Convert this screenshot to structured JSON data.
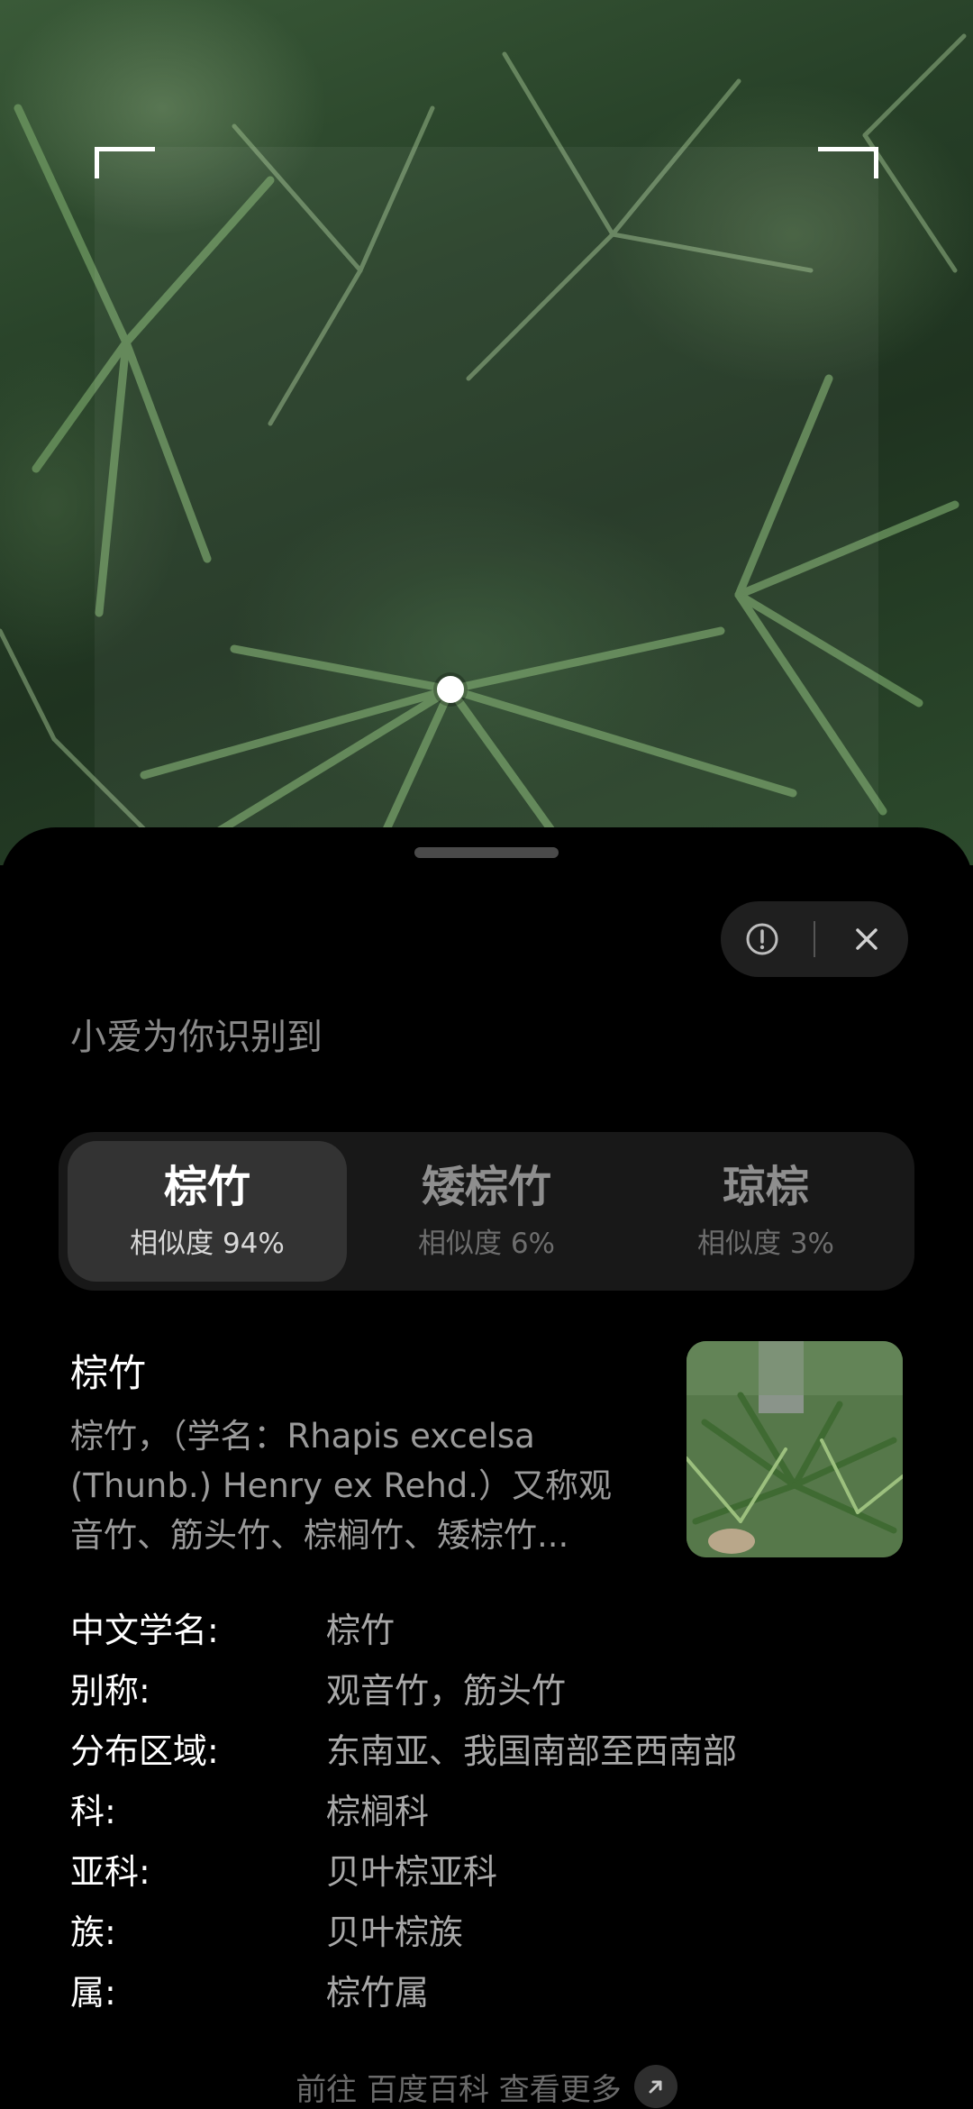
{
  "header": {
    "headline": "小爱为你识别到"
  },
  "candidates": [
    {
      "name": "棕竹",
      "similarity": "相似度 94%",
      "active": true
    },
    {
      "name": "矮棕竹",
      "similarity": "相似度 6%",
      "active": false
    },
    {
      "name": "琼棕",
      "similarity": "相似度 3%",
      "active": false
    }
  ],
  "detail": {
    "title": "棕竹",
    "description": "棕竹，（学名：Rhapis excelsa (Thunb.) Henry ex Rehd.）又称观音竹、筋头竹、棕榈竹、矮棕竹...",
    "attributes": [
      {
        "key": "中文学名:",
        "value": "棕竹"
      },
      {
        "key": "别称:",
        "value": "观音竹，筋头竹"
      },
      {
        "key": "分布区域:",
        "value": "东南亚、我国南部至西南部"
      },
      {
        "key": "科:",
        "value": "棕榈科"
      },
      {
        "key": "亚科:",
        "value": "贝叶棕亚科"
      },
      {
        "key": "族:",
        "value": "贝叶棕族"
      },
      {
        "key": "属:",
        "value": "棕竹属"
      }
    ]
  },
  "footer": {
    "more_link": "前往 百度百科 查看更多"
  },
  "icons": {
    "feedback": "exclamation-circle-icon",
    "close": "close-icon",
    "external": "arrow-up-right-icon"
  }
}
